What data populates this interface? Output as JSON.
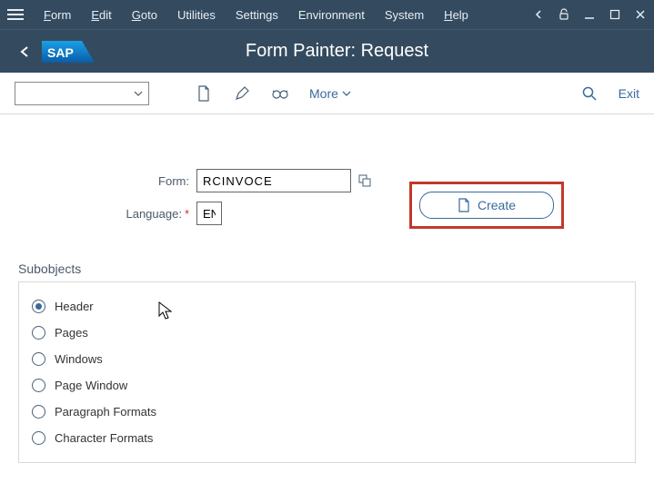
{
  "menus": {
    "form": "Form",
    "edit": "Edit",
    "goto": "Goto",
    "utilities": "Utilities",
    "settings": "Settings",
    "environment": "Environment",
    "system": "System",
    "help": "Help"
  },
  "titlebar": {
    "title": "Form Painter: Request"
  },
  "toolbar": {
    "more": "More",
    "exit": "Exit"
  },
  "form": {
    "form_label": "Form:",
    "form_value": "RCINVOCE",
    "lang_label": "Language:",
    "lang_value": "EN",
    "create_label": "Create"
  },
  "subobjects": {
    "title": "Subobjects",
    "items": [
      {
        "label": "Header",
        "selected": true
      },
      {
        "label": "Pages",
        "selected": false
      },
      {
        "label": "Windows",
        "selected": false
      },
      {
        "label": "Page Window",
        "selected": false
      },
      {
        "label": "Paragraph Formats",
        "selected": false
      },
      {
        "label": "Character Formats",
        "selected": false
      }
    ]
  }
}
